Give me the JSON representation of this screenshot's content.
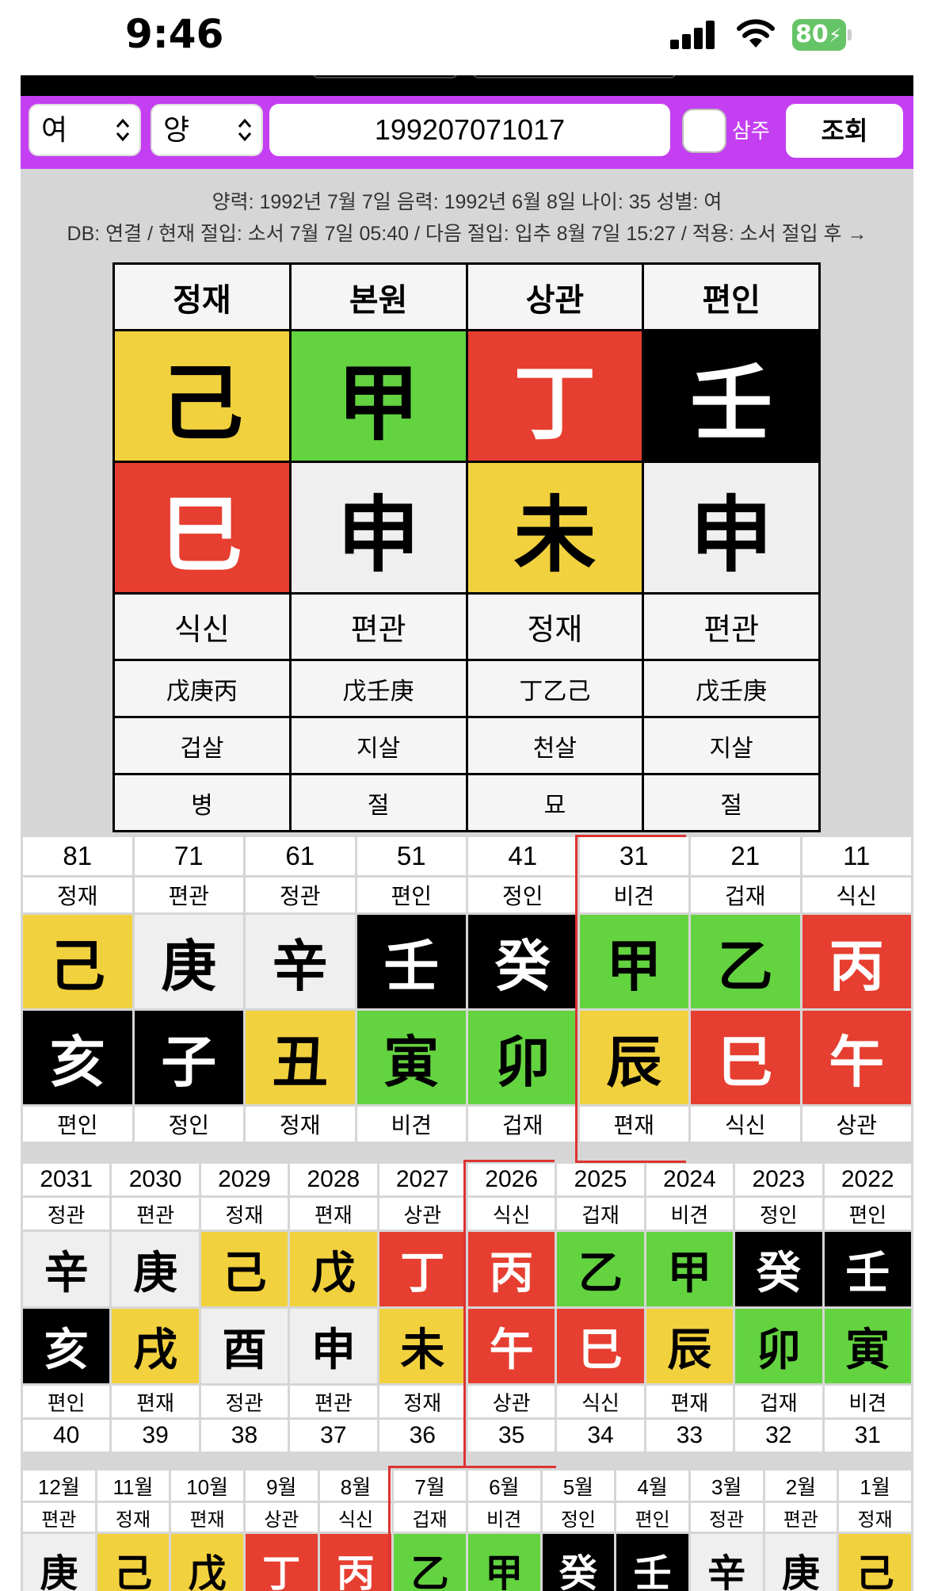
{
  "status_bar": {
    "time": "9:46",
    "battery": "80"
  },
  "controls": {
    "gender_select": "여",
    "yinyang_select": "양",
    "birth_input": "199207071017",
    "saju_checkbox_label": "삼주",
    "search_button": "조회"
  },
  "info": {
    "line1": "양력: 1992년 7월 7일    음력: 1992년 6월 8일    나이: 35    성별: 여",
    "line2": "DB: 연결 / 현재 절입: 소서 7월 7일 05:40 / 다음 절입: 입추 8월 7일 15:27 / 적용: 소서 절입 후 →"
  },
  "palette": {
    "yellow": "#f2d13e",
    "green": "#63d340",
    "red": "#e63e30",
    "black": "#000000",
    "light": "#efefef"
  },
  "pillars": [
    {
      "ten_god_top": "정재",
      "stem": "己",
      "stem_color": "yellow",
      "branch": "巳",
      "branch_color": "red",
      "ten_god_bottom": "식신",
      "hidden": "戊庚丙",
      "shinsal": "겁살",
      "stage": "병"
    },
    {
      "ten_god_top": "본원",
      "stem": "甲",
      "stem_color": "green",
      "branch": "申",
      "branch_color": "light",
      "ten_god_bottom": "편관",
      "hidden": "戊壬庚",
      "shinsal": "지살",
      "stage": "절"
    },
    {
      "ten_god_top": "상관",
      "stem": "丁",
      "stem_color": "red",
      "branch": "未",
      "branch_color": "yellow",
      "ten_god_bottom": "정재",
      "hidden": "丁乙己",
      "shinsal": "천살",
      "stage": "묘"
    },
    {
      "ten_god_top": "편인",
      "stem": "壬",
      "stem_color": "black",
      "branch": "申",
      "branch_color": "light",
      "ten_god_bottom": "편관",
      "hidden": "戊壬庚",
      "shinsal": "지살",
      "stage": "절"
    }
  ],
  "daeyun": [
    {
      "age": "81",
      "top": "정재",
      "stem": "己",
      "stem_color": "yellow",
      "branch": "亥",
      "branch_color": "black",
      "bottom": "편인"
    },
    {
      "age": "71",
      "top": "편관",
      "stem": "庚",
      "stem_color": "light",
      "branch": "子",
      "branch_color": "black",
      "bottom": "정인"
    },
    {
      "age": "61",
      "top": "정관",
      "stem": "辛",
      "stem_color": "light",
      "branch": "丑",
      "branch_color": "yellow",
      "bottom": "정재"
    },
    {
      "age": "51",
      "top": "편인",
      "stem": "壬",
      "stem_color": "black",
      "branch": "寅",
      "branch_color": "green",
      "bottom": "비견"
    },
    {
      "age": "41",
      "top": "정인",
      "stem": "癸",
      "stem_color": "black",
      "branch": "卯",
      "branch_color": "green",
      "bottom": "겁재"
    },
    {
      "age": "31",
      "top": "비견",
      "stem": "甲",
      "stem_color": "green",
      "branch": "辰",
      "branch_color": "yellow",
      "bottom": "편재"
    },
    {
      "age": "21",
      "top": "겁재",
      "stem": "乙",
      "stem_color": "green",
      "branch": "巳",
      "branch_color": "red",
      "bottom": "식신"
    },
    {
      "age": "11",
      "top": "식신",
      "stem": "丙",
      "stem_color": "red",
      "branch": "午",
      "branch_color": "red",
      "bottom": "상관"
    }
  ],
  "yearly": [
    {
      "year": "2031",
      "top": "정관",
      "stem": "辛",
      "stem_color": "light",
      "branch": "亥",
      "branch_color": "black",
      "bottom": "편인",
      "age": "40"
    },
    {
      "year": "2030",
      "top": "편관",
      "stem": "庚",
      "stem_color": "light",
      "branch": "戌",
      "branch_color": "yellow",
      "bottom": "편재",
      "age": "39"
    },
    {
      "year": "2029",
      "top": "정재",
      "stem": "己",
      "stem_color": "yellow",
      "branch": "酉",
      "branch_color": "light",
      "bottom": "정관",
      "age": "38"
    },
    {
      "year": "2028",
      "top": "편재",
      "stem": "戊",
      "stem_color": "yellow",
      "branch": "申",
      "branch_color": "light",
      "bottom": "편관",
      "age": "37"
    },
    {
      "year": "2027",
      "top": "상관",
      "stem": "丁",
      "stem_color": "red",
      "branch": "未",
      "branch_color": "yellow",
      "bottom": "정재",
      "age": "36"
    },
    {
      "year": "2026",
      "top": "식신",
      "stem": "丙",
      "stem_color": "red",
      "branch": "午",
      "branch_color": "red",
      "bottom": "상관",
      "age": "35"
    },
    {
      "year": "2025",
      "top": "겁재",
      "stem": "乙",
      "stem_color": "green",
      "branch": "巳",
      "branch_color": "red",
      "bottom": "식신",
      "age": "34"
    },
    {
      "year": "2024",
      "top": "비견",
      "stem": "甲",
      "stem_color": "green",
      "branch": "辰",
      "branch_color": "yellow",
      "bottom": "편재",
      "age": "33"
    },
    {
      "year": "2023",
      "top": "정인",
      "stem": "癸",
      "stem_color": "black",
      "branch": "卯",
      "branch_color": "green",
      "bottom": "겁재",
      "age": "32"
    },
    {
      "year": "2022",
      "top": "편인",
      "stem": "壬",
      "stem_color": "black",
      "branch": "寅",
      "branch_color": "green",
      "bottom": "비견",
      "age": "31"
    }
  ],
  "monthly": [
    {
      "month": "12월",
      "top": "편관",
      "stem": "庚",
      "stem_color": "light"
    },
    {
      "month": "11월",
      "top": "정재",
      "stem": "己",
      "stem_color": "yellow"
    },
    {
      "month": "10월",
      "top": "편재",
      "stem": "戊",
      "stem_color": "yellow"
    },
    {
      "month": "9월",
      "top": "상관",
      "stem": "丁",
      "stem_color": "red"
    },
    {
      "month": "8월",
      "top": "식신",
      "stem": "丙",
      "stem_color": "red"
    },
    {
      "month": "7월",
      "top": "겁재",
      "stem": "乙",
      "stem_color": "green"
    },
    {
      "month": "6월",
      "top": "비견",
      "stem": "甲",
      "stem_color": "green"
    },
    {
      "month": "5월",
      "top": "정인",
      "stem": "癸",
      "stem_color": "black"
    },
    {
      "month": "4월",
      "top": "편인",
      "stem": "壬",
      "stem_color": "black"
    },
    {
      "month": "3월",
      "top": "정관",
      "stem": "辛",
      "stem_color": "light"
    },
    {
      "month": "2월",
      "top": "편관",
      "stem": "庚",
      "stem_color": "light"
    },
    {
      "month": "1월",
      "top": "정재",
      "stem": "己",
      "stem_color": "yellow"
    }
  ]
}
